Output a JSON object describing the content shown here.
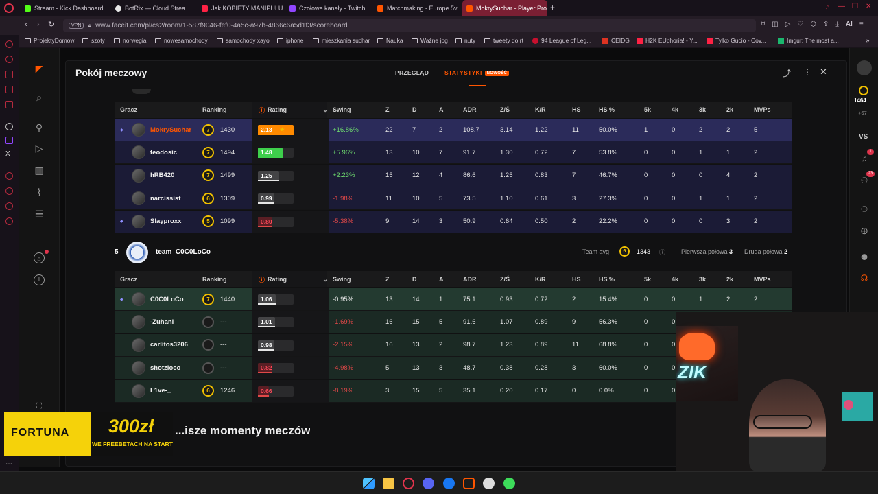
{
  "browser": {
    "tabs": [
      {
        "label": "Stream - Kick Dashboard",
        "color": "#53fc18"
      },
      {
        "label": "BotRix — Cloud Strea",
        "color": "#e8e8e8"
      },
      {
        "label": "Jak KOBIETY MANIPULU...",
        "color": "#ff2244"
      },
      {
        "label": "Czołowe kanały - Twitch",
        "color": "#9146ff"
      },
      {
        "label": "Matchmaking - Europe 5v",
        "color": "#ff5500"
      },
      {
        "label": "MokrySuchar - Player Prof",
        "color": "#ff5500"
      }
    ],
    "url": "www.faceit.com/pl/cs2/room/1-587f9046-fef0-4a5c-a97b-4866c6a5d1f3/scoreboard",
    "vpn": "VPN",
    "ai": "AI",
    "bookmarks": [
      "ProjektyDomow",
      "szoty",
      "norwegia",
      "nowesamochody",
      "samochody xayo",
      "iphone",
      "mieszkania suchar",
      "Nauka",
      "Ważne jpg",
      "nuty",
      "tweety do rt",
      "94 League of Leg...",
      "CEIDG",
      "H2K EUphoria! - Y...",
      "Tylko Gucio - Cov...",
      "Imgur: The most a..."
    ]
  },
  "page": {
    "title": "Pokój meczowy",
    "tab_overview": "PRZEGLĄD",
    "tab_stats": "STATYSTYKI",
    "tab_stats_badge": "NOWOŚĆ"
  },
  "columns": [
    "Gracz",
    "Ranking",
    "Rating",
    "Swing",
    "Z",
    "D",
    "A",
    "ADR",
    "Z/Ś",
    "K/R",
    "HS",
    "HS %",
    "5k",
    "4k",
    "3k",
    "2k",
    "MVPs"
  ],
  "team1": {
    "players": [
      {
        "name": "MokrySuchar",
        "level": "7",
        "elo": "1430",
        "rating": "2.13",
        "rating_level": 1.0,
        "swing": "+16.86%",
        "z": "22",
        "d": "7",
        "a": "2",
        "adr": "108.7",
        "zs": "3.14",
        "kr": "1.22",
        "hs": "11",
        "hsp": "50.0%",
        "k5": "1",
        "k4": "0",
        "k3": "2",
        "k2": "2",
        "mvps": "5",
        "highlight": true,
        "star": "★"
      },
      {
        "name": "teodosic",
        "level": "7",
        "elo": "1494",
        "rating": "1.48",
        "rating_level": 0.7,
        "swing": "+5.96%",
        "z": "13",
        "d": "10",
        "a": "7",
        "adr": "91.7",
        "zs": "1.30",
        "kr": "0.72",
        "hs": "7",
        "hsp": "53.8%",
        "k5": "0",
        "k4": "0",
        "k3": "1",
        "k2": "1",
        "mvps": "2"
      },
      {
        "name": "hRB420",
        "level": "7",
        "elo": "1499",
        "rating": "1.25",
        "rating_level": 0.6,
        "swing": "+2.23%",
        "z": "15",
        "d": "12",
        "a": "4",
        "adr": "86.6",
        "zs": "1.25",
        "kr": "0.83",
        "hs": "7",
        "hsp": "46.7%",
        "k5": "0",
        "k4": "0",
        "k3": "0",
        "k2": "4",
        "mvps": "2"
      },
      {
        "name": "narcissist",
        "level": "6",
        "elo": "1309",
        "rating": "0.99",
        "rating_level": 0.47,
        "swing": "-1.98%",
        "z": "11",
        "d": "10",
        "a": "5",
        "adr": "73.5",
        "zs": "1.10",
        "kr": "0.61",
        "hs": "3",
        "hsp": "27.3%",
        "k5": "0",
        "k4": "0",
        "k3": "1",
        "k2": "1",
        "mvps": "2"
      },
      {
        "name": "Slayproxx",
        "level": "5",
        "elo": "1099",
        "rating": "0.80",
        "rating_level": 0.38,
        "swing": "-5.38%",
        "z": "9",
        "d": "14",
        "a": "3",
        "adr": "50.9",
        "zs": "0.64",
        "kr": "0.50",
        "hs": "2",
        "hsp": "22.2%",
        "k5": "0",
        "k4": "0",
        "k3": "0",
        "k2": "3",
        "mvps": "2"
      }
    ]
  },
  "team2": {
    "score": "5",
    "name": "team_C0C0LoCo",
    "team_avg_label": "Team avg",
    "team_avg_level": "6",
    "team_avg_elo": "1343",
    "first_half_label": "Pierwsza połowa",
    "first_half": "3",
    "second_half_label": "Druga połowa",
    "second_half": "2",
    "players": [
      {
        "name": "C0C0LoCo",
        "level": "7",
        "elo": "1440",
        "rating": "1.06",
        "rating_level": 0.5,
        "swing": "-0.95%",
        "z": "13",
        "d": "14",
        "a": "1",
        "adr": "75.1",
        "zs": "0.93",
        "kr": "0.72",
        "hs": "2",
        "hsp": "15.4%",
        "k5": "0",
        "k4": "0",
        "k3": "1",
        "k2": "2",
        "mvps": "2",
        "highlight": true
      },
      {
        "name": "-Zuhani",
        "level": "",
        "elo": "---",
        "rating": "1.01",
        "rating_level": 0.48,
        "swing": "-1.69%",
        "z": "16",
        "d": "15",
        "a": "5",
        "adr": "91.6",
        "zs": "1.07",
        "kr": "0.89",
        "hs": "9",
        "hsp": "56.3%",
        "k5": "0",
        "k4": "0",
        "k3": "",
        "k2": "",
        "mvps": ""
      },
      {
        "name": "carlitos3206",
        "level": "",
        "elo": "---",
        "rating": "0.98",
        "rating_level": 0.46,
        "swing": "-2.15%",
        "z": "16",
        "d": "13",
        "a": "2",
        "adr": "98.7",
        "zs": "1.23",
        "kr": "0.89",
        "hs": "11",
        "hsp": "68.8%",
        "k5": "0",
        "k4": "0",
        "k3": "",
        "k2": "",
        "mvps": ""
      },
      {
        "name": "shotzloco",
        "level": "",
        "elo": "---",
        "rating": "0.82",
        "rating_level": 0.39,
        "swing": "-4.98%",
        "z": "5",
        "d": "13",
        "a": "3",
        "adr": "48.7",
        "zs": "0.38",
        "kr": "0.28",
        "hs": "3",
        "hsp": "60.0%",
        "k5": "0",
        "k4": "0",
        "k3": "",
        "k2": "",
        "mvps": ""
      },
      {
        "name": "L1ve-_",
        "level": "6",
        "elo": "1246",
        "rating": "0.66",
        "rating_level": 0.31,
        "swing": "-8.19%",
        "z": "3",
        "d": "15",
        "a": "5",
        "adr": "35.1",
        "zs": "0.20",
        "kr": "0.17",
        "hs": "0",
        "hsp": "0.0%",
        "k5": "0",
        "k4": "0",
        "k3": "",
        "k2": "",
        "mvps": ""
      }
    ]
  },
  "below_heading": "...isze momenty meczów",
  "right_sidebar": {
    "elo": "1464",
    "elo_delta": "+67",
    "vs": "VS",
    "notif_count": "1",
    "friends_count": "23"
  },
  "overlay": {
    "brand": "FORTUNA",
    "amount": "300zł",
    "promo": "WE FREEBETACH NA START",
    "brand_right": "ZIK"
  }
}
